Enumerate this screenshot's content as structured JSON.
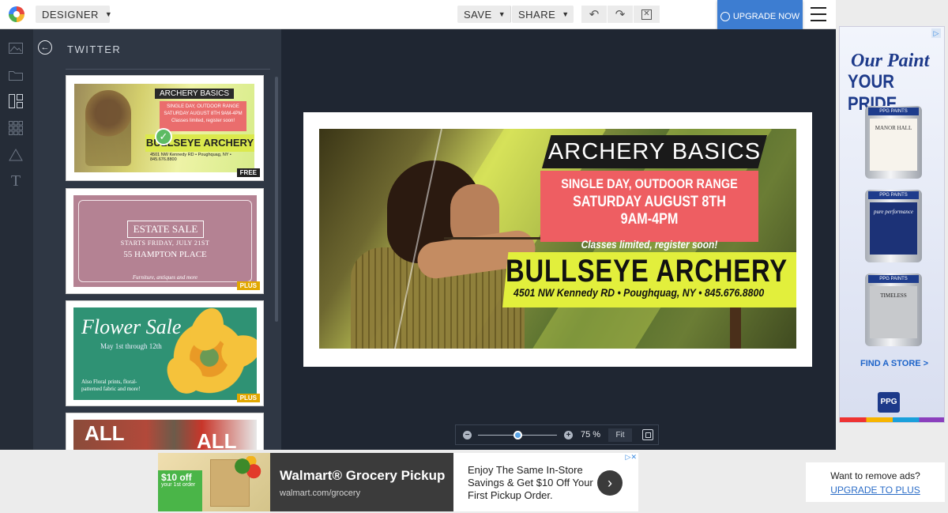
{
  "topbar": {
    "designer_label": "DESIGNER",
    "save_label": "SAVE",
    "share_label": "SHARE",
    "upgrade_label": "UPGRADE NOW"
  },
  "rail": {
    "icons": [
      "image-icon",
      "folder-icon",
      "templates-icon",
      "grid-icon",
      "shapes-icon",
      "text-icon"
    ]
  },
  "panel": {
    "title": "TWITTER",
    "templates": [
      {
        "name": "Archery Basics",
        "badge": "FREE",
        "title": "ARCHERY BASICS",
        "line1": "SINGLE DAY, OUTDOOR RANGE",
        "line2": "SATURDAY AUGUST 8TH 9AM-4PM",
        "line3": "Classes limited, register soon!",
        "brand": "BULLSEYE ARCHERY",
        "address": "4501 NW Kennedy RD • Poughquag, NY • 845.676.8800"
      },
      {
        "name": "Estate Sale",
        "badge": "PLUS",
        "title": "ESTATE SALE",
        "line1": "STARTS FRIDAY, JULY 21ST",
        "line2": "55 HAMPTON PLACE",
        "line3": "Furniture, antiques and more"
      },
      {
        "name": "Flower Sale",
        "badge": "PLUS",
        "title": "Flower Sale",
        "line1": "May 1st through 12th",
        "line2": "Also Floral prints, floral-patterned fabric and more!"
      },
      {
        "name": "All",
        "title": "ALL",
        "title2": "ALL"
      }
    ]
  },
  "design": {
    "title": "ARCHERY BASICS",
    "line1": "SINGLE DAY, OUTDOOR RANGE",
    "line2": "SATURDAY AUGUST 8TH 9AM-4PM",
    "line3": "Classes limited, register soon!",
    "brand": "BULLSEYE ARCHERY",
    "address": "4501 NW Kennedy RD • Poughquag, NY • 845.676.8800",
    "colors": {
      "accent_yellow": "#e2ef3c",
      "accent_red": "#ee5e62",
      "dark": "#1a1a1a"
    }
  },
  "zoom": {
    "value": 0.5,
    "label": "75 %",
    "fit_label": "Fit"
  },
  "side_ad": {
    "headline1": "Our Paint",
    "headline2": "YOUR PRIDE",
    "cans": [
      {
        "brand": "PPG PAINTS",
        "label": "MANOR HALL"
      },
      {
        "brand": "PPG PAINTS",
        "label": "pure performance"
      },
      {
        "brand": "PPG PAINTS",
        "label": "TIMELESS"
      }
    ],
    "cta": "FIND A STORE >",
    "logo": "PPG"
  },
  "bottom_ad": {
    "promo_big": "$10 off",
    "promo_small": "your 1st order",
    "title": "Walmart® Grocery Pickup",
    "url": "walmart.com/grocery",
    "body": "Enjoy The Same In-Store Savings & Get $10 Off Your First Pickup Order."
  },
  "remove_ads": {
    "question": "Want to remove ads?",
    "link": "UPGRADE TO PLUS"
  },
  "colors": {
    "topbar_bg": "#ffffff",
    "rail_bg": "#252c37",
    "panel_bg": "#2f3744",
    "workspace_bg": "#1f2632",
    "upgrade_blue": "#3d7dd1",
    "badge_plus": "#e2a800"
  }
}
